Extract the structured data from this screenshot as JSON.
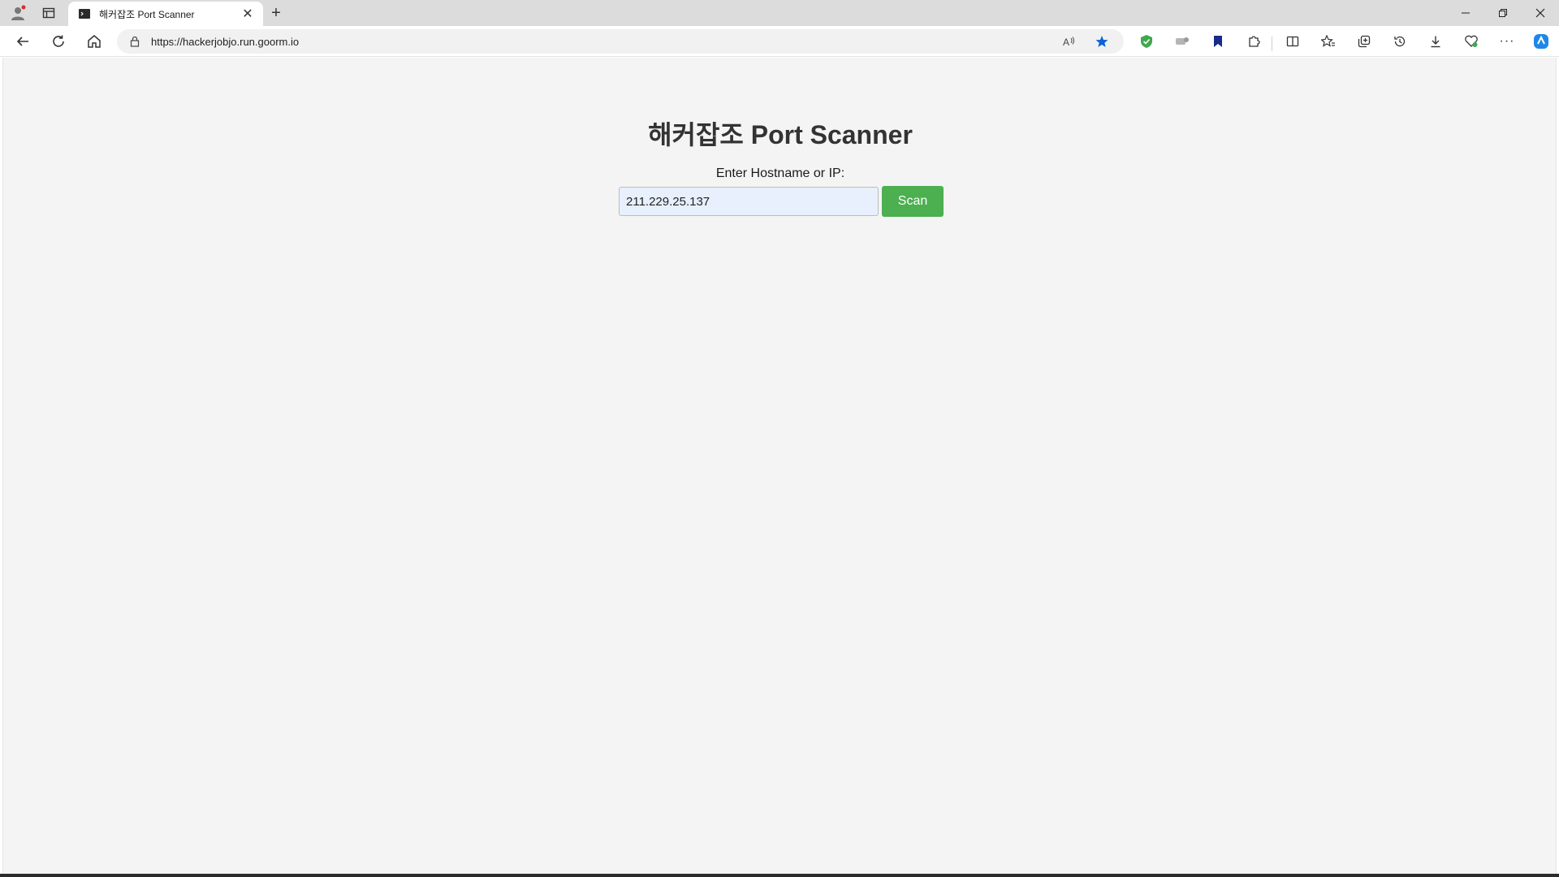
{
  "browser": {
    "tab": {
      "title": "해커잡조 Port Scanner"
    },
    "address": {
      "url": "https://hackerjobjo.run.goorm.io"
    },
    "new_tab_symbol": "+",
    "more_symbol": "···"
  },
  "page": {
    "title": "해커잡조 Port Scanner",
    "form": {
      "label": "Enter Hostname or IP:",
      "input_value": "211.229.25.137",
      "button_label": "Scan"
    }
  },
  "colors": {
    "accent_button": "#4caf50",
    "page_background": "#f4f4f4",
    "input_autofill": "#e8f0fe"
  }
}
